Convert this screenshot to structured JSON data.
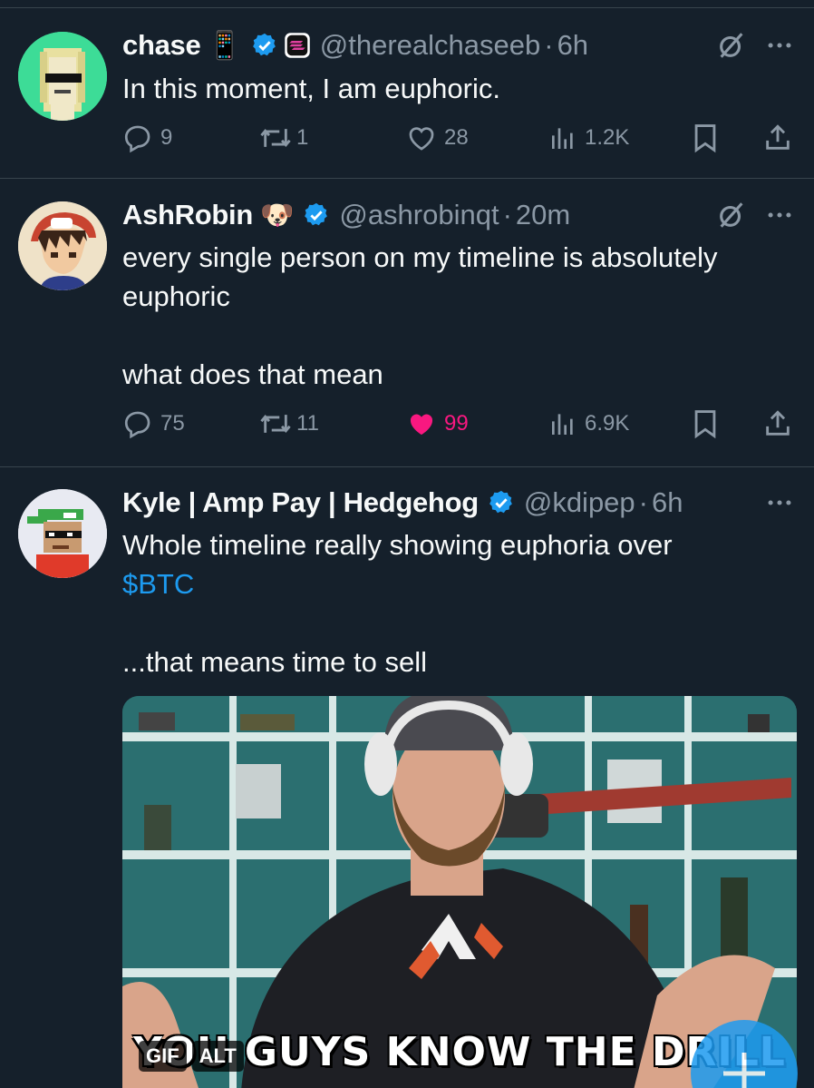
{
  "tweets": [
    {
      "name": "chase",
      "name_emoji": "📱",
      "handle": "@therealchaseeb",
      "time": "6h",
      "text_lines": [
        "In this moment, I am euphoric."
      ],
      "actions": {
        "replies": "9",
        "reposts": "1",
        "likes": "28",
        "views": "1.2K"
      },
      "liked": false
    },
    {
      "name": "AshRobin",
      "name_emoji": "🐶",
      "handle": "@ashrobinqt",
      "time": "20m",
      "text_lines": [
        "every single person on my timeline is absolutely",
        "euphoric",
        "",
        "what does that mean"
      ],
      "actions": {
        "replies": "75",
        "reposts": "11",
        "likes": "99",
        "views": "6.9K"
      },
      "liked": true
    },
    {
      "name": "Kyle | Amp Pay | Hedgehog",
      "handle": "@kdipep",
      "time": "6h",
      "text_line1": "Whole timeline really showing euphoria over",
      "cashtag": "$BTC",
      "text_line3": "...that means time to sell",
      "media": {
        "badges": [
          "GIF",
          "ALT"
        ],
        "caption": "YOU GUYS KNOW THE DRILL"
      }
    }
  ],
  "dot": "·",
  "colors": {
    "background": "#15202b",
    "accent": "#1d9bf0",
    "like": "#f91880",
    "muted": "#8b98a5"
  },
  "icons": [
    "reply-icon",
    "repost-icon",
    "like-icon",
    "views-icon",
    "bookmark-icon",
    "share-icon",
    "grok-icon",
    "more-icon",
    "verified-icon"
  ]
}
